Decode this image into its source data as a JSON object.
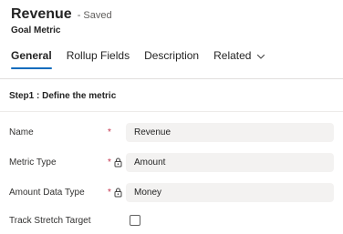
{
  "record": {
    "title": "Revenue",
    "status": "- Saved",
    "entity": "Goal Metric"
  },
  "tabs": [
    {
      "label": "General",
      "active": true
    },
    {
      "label": "Rollup Fields",
      "active": false
    },
    {
      "label": "Description",
      "active": false
    },
    {
      "label": "Related",
      "active": false,
      "has_dropdown": true
    }
  ],
  "section": {
    "title": "Step1 : Define the metric"
  },
  "fields": {
    "name": {
      "label": "Name",
      "required": "*",
      "value": "Revenue"
    },
    "metric_type": {
      "label": "Metric Type",
      "required": "*",
      "value": "Amount",
      "locked": true
    },
    "amount_data_type": {
      "label": "Amount Data Type",
      "required": "*",
      "value": "Money",
      "locked": true
    },
    "track_stretch_target": {
      "label": "Track Stretch Target",
      "checked": false
    }
  },
  "colors": {
    "accent": "#0f6cbd",
    "required": "#c4314b",
    "field_bg": "#f3f2f1"
  }
}
